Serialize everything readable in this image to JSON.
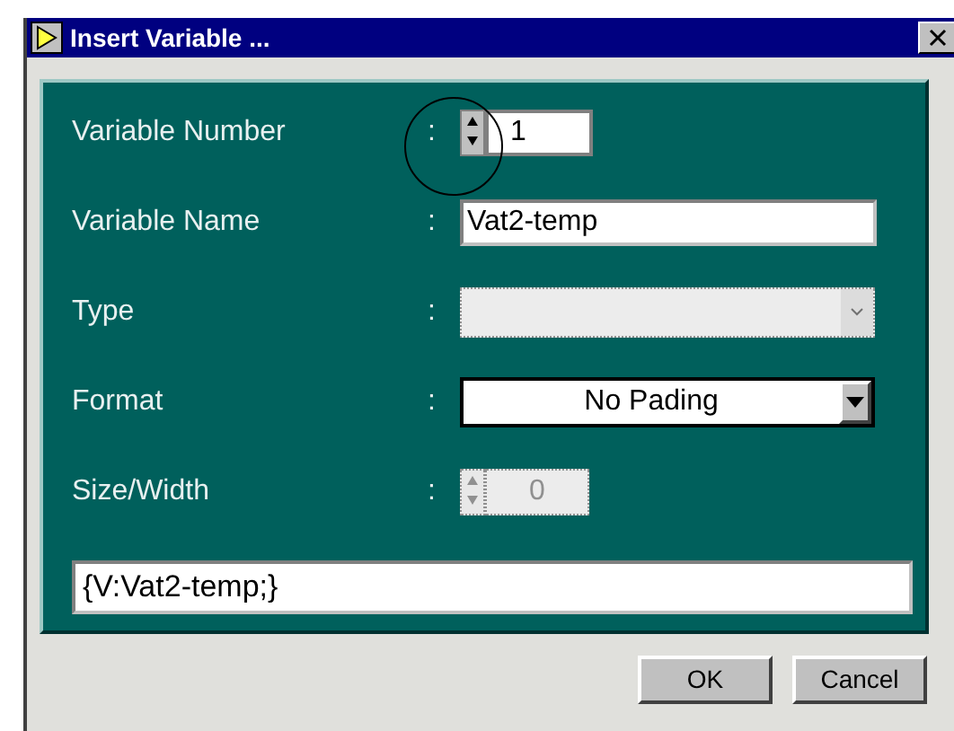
{
  "window": {
    "title": "Insert Variable ..."
  },
  "fields": [
    {
      "kind": "spinner",
      "label": "Variable Number",
      "separator": ":",
      "value": "1",
      "disabled": false
    },
    {
      "kind": "text",
      "label": "Variable Name",
      "separator": ":",
      "value": "Vat2-temp"
    },
    {
      "kind": "dropdown",
      "label": "Type",
      "separator": ":",
      "disabled": true
    },
    {
      "kind": "dropdown",
      "label": "Format",
      "separator": ":",
      "value": "No Pading",
      "disabled": false
    },
    {
      "kind": "spinner",
      "label": "Size/Width",
      "separator": ":",
      "value": "0",
      "disabled": true
    }
  ],
  "result": {
    "value": "{V:Vat2-temp;}"
  },
  "buttons": [
    "OK",
    "Cancel"
  ]
}
